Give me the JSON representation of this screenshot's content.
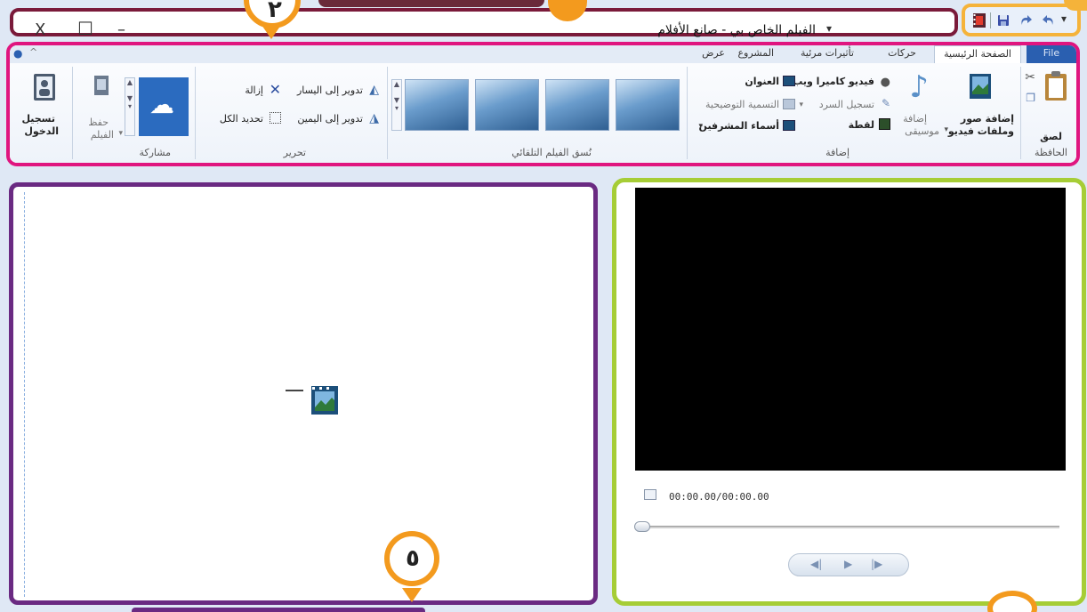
{
  "window": {
    "title": "الفيلم الخاص بي - صانع الأفلام",
    "close_glyph": "X",
    "maximize_glyph": "☐",
    "minimize_glyph": "–"
  },
  "callouts": {
    "pin_top_left": "٢",
    "pin_bottom": "٥"
  },
  "ribbon": {
    "tabs": [
      {
        "label": "File"
      },
      {
        "label": "الصفحة الرئيسية"
      },
      {
        "label": "حركات"
      },
      {
        "label": "تأثيرات مرئية"
      },
      {
        "label": "المشروع"
      },
      {
        "label": "عرض"
      }
    ],
    "groups": {
      "clipboard": {
        "label": "الحافظة",
        "paste": "لصق"
      },
      "add": {
        "label": "إضافة",
        "add_videos": "إضافة صور وملفات فيديو",
        "add_videos_line1": "إضافة صور",
        "add_videos_line2": "وملفات فيديو",
        "add_music_line1": "إضافة",
        "add_music_line2": "موسيقى",
        "webcam": "فيديو كاميرا ويب",
        "narration": "تسجيل السرد",
        "snapshot": "لقطة",
        "title": "العنوان",
        "caption": "التسمية التوضيحية",
        "credits": "أسماء المشرفين"
      },
      "automovie": {
        "label": "نُسق الفيلم التلقائي"
      },
      "editing": {
        "label": "تحرير",
        "rotate_left": "تدوير إلى اليسار",
        "rotate_right": "تدوير إلى اليمين",
        "remove": "إزالة",
        "select_all": "تحديد الكل"
      },
      "share": {
        "label": "مشاركة",
        "save_line1": "حفظ",
        "save_line2": "الفيلم"
      },
      "signin": {
        "line1": "تسجيل",
        "line2": "الدخول"
      }
    }
  },
  "preview": {
    "time": "00:00.00/00:00.00",
    "progress": 0
  },
  "colors": {
    "title_frame": "#7a1a3a",
    "qat_frame": "#f5b33a",
    "ribbon_frame": "#e0157f",
    "storyboard_frame": "#6a2a82",
    "preview_frame": "#a6cd36",
    "pin": "#f39a1e",
    "file_tab": "#2a5fb0"
  }
}
